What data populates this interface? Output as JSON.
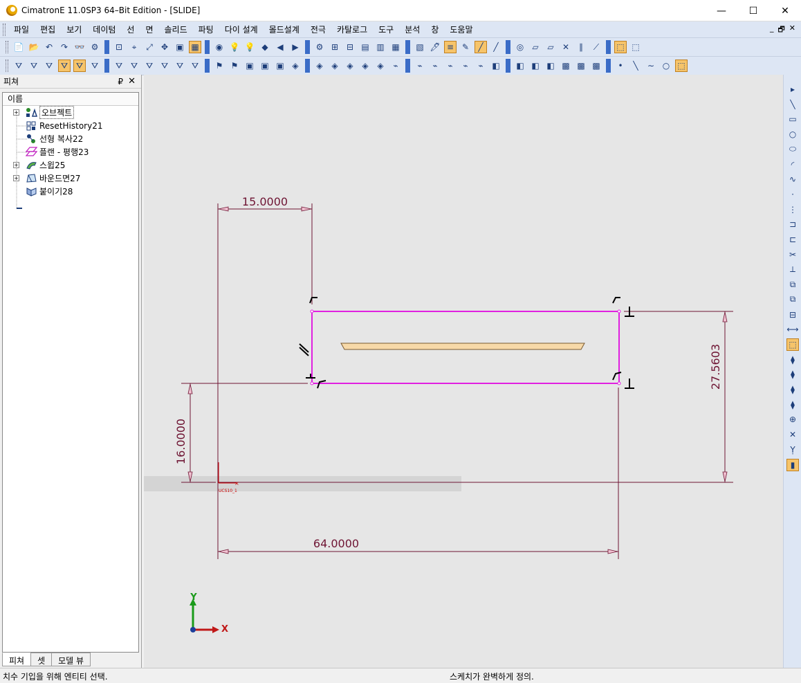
{
  "window": {
    "title": "CimatronE 11.0SP3 64–Bit Edition - [SLIDE]",
    "minimize": "—",
    "maximize": "☐",
    "close": "✕"
  },
  "menubar": {
    "items": [
      "파일",
      "편집",
      "보기",
      "데이텀",
      "선",
      "면",
      "솔리드",
      "파팅",
      "다이 설계",
      "몰드설계",
      "전극",
      "카탈로그",
      "도구",
      "분석",
      "창",
      "도움말"
    ],
    "mdi_controls": [
      "_",
      "🗗",
      "✕"
    ]
  },
  "toolbars": {
    "row1": [
      "📄",
      "📂",
      "↶",
      "↷",
      "👓",
      "⚙",
      "⊡",
      "⌖",
      "⤢",
      "✥",
      "▣",
      "▦",
      "◉",
      "💡",
      "💡",
      "◆",
      "◀",
      "▶",
      "⚙",
      "⊞",
      "⊟",
      "▤",
      "▥",
      "▦",
      "▧",
      "🖊",
      "≡",
      "✎",
      "╱",
      "╱",
      "◎",
      "▱",
      "▱",
      "✕",
      "∥",
      "⟋",
      "⬚",
      "⬚"
    ],
    "row2": [
      "⛛",
      "⛛",
      "⛛",
      "⛛",
      "⛛",
      "⛛",
      "⛛",
      "⛛",
      "⛛",
      "⛛",
      "⛛",
      "⛛",
      "⚑",
      "⚑",
      "▣",
      "▣",
      "▣",
      "◈",
      "◈",
      "◈",
      "◈",
      "◈",
      "◈",
      "⌁",
      "⌁",
      "⌁",
      "⌁",
      "⌁",
      "⌁",
      "◧",
      "◧",
      "◧",
      "◧",
      "▩",
      "▩",
      "▩",
      "•",
      "╲",
      "∼",
      "○",
      "⬚"
    ]
  },
  "panel": {
    "title": "피쳐",
    "pin": "₽",
    "close": "✕",
    "column_header": "이름",
    "tree": [
      {
        "label": "오브젝트",
        "icon": "objects-icon",
        "expand": "+"
      },
      {
        "label": "ResetHistory21",
        "icon": "reset-history-icon",
        "expand": ""
      },
      {
        "label": "선형 복사22",
        "icon": "linear-copy-icon",
        "expand": ""
      },
      {
        "label": "플랜 - 평행23",
        "icon": "plane-parallel-icon",
        "expand": ""
      },
      {
        "label": "스윕25",
        "icon": "sweep-icon",
        "expand": "+"
      },
      {
        "label": "바운드면27",
        "icon": "bound-face-icon",
        "expand": "+"
      },
      {
        "label": "붙이기28",
        "icon": "attach-icon",
        "expand": ""
      }
    ],
    "tabs": [
      "피쳐",
      "셋",
      "모델 뷰"
    ]
  },
  "canvas": {
    "dimensions": {
      "top_width": "15.0000",
      "height_right": "27.5603",
      "height_left": "16.0000",
      "bottom_width": "64.0000"
    },
    "ucs_label": "UCS10_1",
    "axis_x": "X",
    "axis_y": "Y",
    "colors": {
      "sketch": "#e020e0",
      "dimension": "#6e1433",
      "background": "#e6e6e6",
      "part_fill": "#f7d9a8"
    }
  },
  "statusbar": {
    "left": "치수 기입을 위해 엔티티 선택.",
    "right": "스케치가 완벽하게 정의."
  }
}
